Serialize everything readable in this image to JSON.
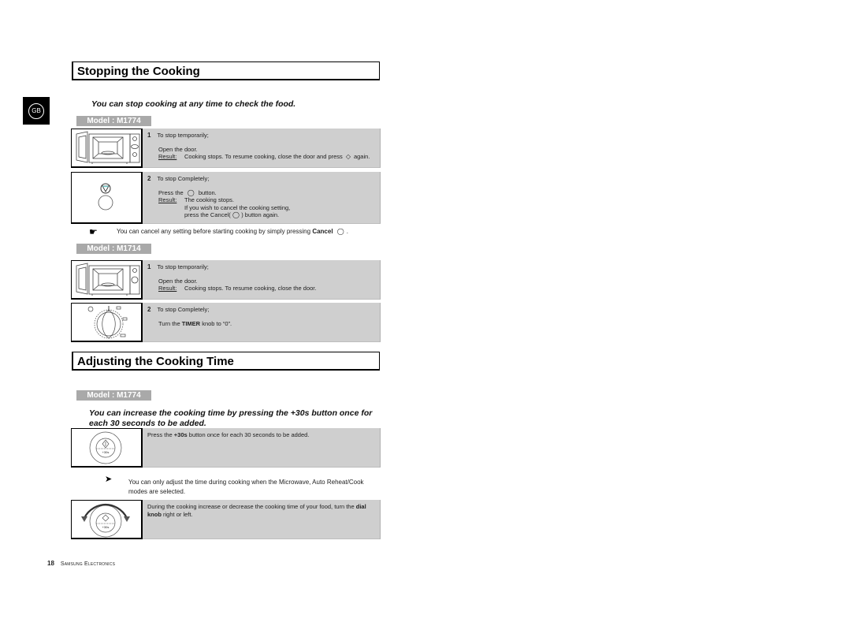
{
  "language_badge": "GB",
  "stopping": {
    "title": "Stopping the Cooking",
    "intro": "You can stop cooking at any time to check the food.",
    "model_a": {
      "label": "Model : M1774",
      "step1": {
        "num": "1",
        "heading": "To stop temporarily;",
        "action": "Open the door.",
        "result_label": "Result:",
        "result_text": "Cooking stops. To resume cooking, close the door and press",
        "result_tail": "again."
      },
      "step2": {
        "num": "2",
        "heading": "To stop Completely;",
        "action_pre": "Press the",
        "action_post": "button.",
        "result_label": "Result:",
        "result_text": "The cooking stops.",
        "result_line2": "If you wish to cancel the cooking setting,",
        "result_line3_pre": "press the Cancel(",
        "result_line3_post": ") button again."
      },
      "note": {
        "text": "You can cancel any setting before starting cooking by simply pressing",
        "bold": "Cancel",
        "tail": "."
      }
    },
    "model_b": {
      "label": "Model : M1714",
      "step1": {
        "num": "1",
        "heading": "To stop temporarily;",
        "action": "Open the door.",
        "result_label": "Result:",
        "result_text": "Cooking stops. To resume cooking, close the door."
      },
      "step2": {
        "num": "2",
        "heading": "To stop Completely;",
        "action_pre": "Turn the",
        "action_bold": "TIMER",
        "action_post": "knob to “0”."
      }
    }
  },
  "adjusting": {
    "title": "Adjusting the Cooking Time",
    "model_label": "Model : M1774",
    "intro": "You can increase the cooking time by pressing the +30s button once for each 30 seconds to be added.",
    "step1": {
      "pre": "Press the",
      "bold": "+30s",
      "post": "button once for each 30 seconds to be added.",
      "button_caption": "+30s"
    },
    "note": "You can only adjust the time during cooking when the Microwave, Auto Reheat/Cook modes are selected.",
    "step2": {
      "pre": "During the cooking increase or decrease the cooking time of your food, turn the",
      "bold": "dial knob",
      "post": "right or left.",
      "button_caption": "+30s"
    }
  },
  "footer": {
    "page_number": "18",
    "brand": "Samsung Electronics"
  }
}
